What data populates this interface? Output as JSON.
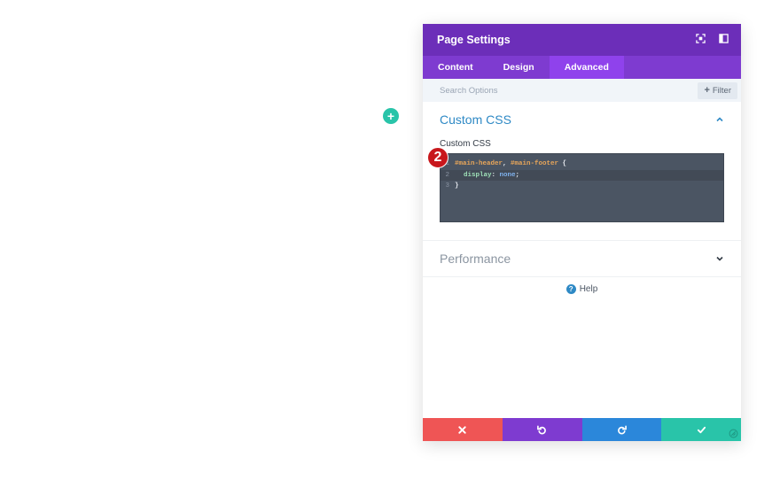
{
  "canvas": {
    "add_label": "+"
  },
  "modal": {
    "title": "Page Settings",
    "tabs": [
      {
        "label": "Content",
        "active": false
      },
      {
        "label": "Design",
        "active": false
      },
      {
        "label": "Advanced",
        "active": true
      }
    ],
    "search": {
      "placeholder": "Search Options",
      "filter_label": "Filter",
      "filter_plus": "+"
    },
    "sections": {
      "custom_css": {
        "title": "Custom CSS",
        "expanded": true,
        "field_label": "Custom CSS",
        "badge": "2",
        "code": {
          "line1": {
            "num": "1",
            "sel1": "#main-header",
            "comma": ", ",
            "sel2": "#main-footer",
            "brace": " {"
          },
          "line2": {
            "num": "2",
            "prop": "display",
            "colon": ": ",
            "val": "none",
            "semi": ";"
          },
          "line3": {
            "num": "3",
            "brace": "}"
          }
        }
      },
      "performance": {
        "title": "Performance",
        "expanded": false
      }
    },
    "help": {
      "icon": "?",
      "label": "Help"
    },
    "footer": {
      "cancel_icon": "close-icon",
      "undo_icon": "undo-icon",
      "redo_icon": "redo-icon",
      "save_icon": "check-icon"
    }
  },
  "colors": {
    "header": "#6c2eb9",
    "tabs": "#7e3bd0",
    "tab_active": "#8f42ec",
    "accent_blue": "#2e89c5",
    "cancel": "#ef5555",
    "undo": "#7e3bd0",
    "redo": "#2b87da",
    "save": "#29c4a9",
    "badge": "#c8171c"
  }
}
